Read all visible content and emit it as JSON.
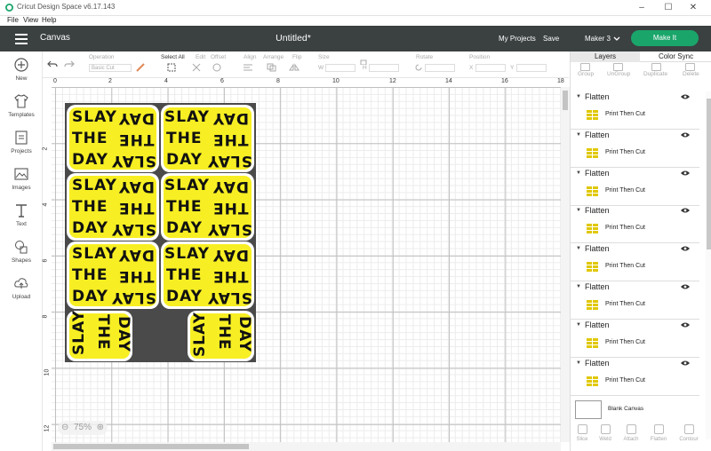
{
  "window": {
    "title": "Cricut Design Space  v6.17.143",
    "minimize": "–",
    "maximize": "☐",
    "close": "✕"
  },
  "menu": [
    "File",
    "View",
    "Help"
  ],
  "header": {
    "page": "Canvas",
    "doc_title": "Untitled*",
    "my_projects": "My Projects",
    "save": "Save",
    "machine": "Maker 3",
    "make_it": "Make It",
    "accent": "#1aa56b",
    "bar_color": "#3b4041"
  },
  "toolbar": {
    "operation_label": "Operation",
    "operation_value": "Basic Cut",
    "select_all": "Select All",
    "edit": "Edit",
    "offset": "Offset",
    "align": "Align",
    "arrange": "Arrange",
    "flip": "Flip",
    "size": "Size",
    "size_w": "W",
    "size_h": "H",
    "rotate": "Rotate",
    "position": "Position",
    "pos_x": "X",
    "pos_y": "Y"
  },
  "sidebar": [
    {
      "label": "New",
      "icon": "plus-circle-icon"
    },
    {
      "label": "Templates",
      "icon": "shirt-icon"
    },
    {
      "label": "Projects",
      "icon": "projects-icon"
    },
    {
      "label": "Images",
      "icon": "image-icon"
    },
    {
      "label": "Text",
      "icon": "text-icon"
    },
    {
      "label": "Shapes",
      "icon": "shapes-icon"
    },
    {
      "label": "Upload",
      "icon": "upload-cloud-icon"
    }
  ],
  "ruler_top": [
    "0",
    "2",
    "4",
    "6",
    "8",
    "10",
    "12",
    "14",
    "16",
    "18"
  ],
  "ruler_left": [
    "2",
    "4",
    "6",
    "8",
    "10",
    "12"
  ],
  "stickers": {
    "line1": "SLAY",
    "line2": "THE",
    "line3": "DAY",
    "fill": "#f7ef23",
    "mat": "#4a4a4a"
  },
  "zoom": "75%",
  "panel": {
    "tabs": [
      "Layers",
      "Color Sync"
    ],
    "actions": [
      "Group",
      "UnGroup",
      "Duplicate",
      "Delete"
    ],
    "layers": [
      {
        "name": "Flatten",
        "op": "Print Then Cut"
      },
      {
        "name": "Flatten",
        "op": "Print Then Cut"
      },
      {
        "name": "Flatten",
        "op": "Print Then Cut"
      },
      {
        "name": "Flatten",
        "op": "Print Then Cut"
      },
      {
        "name": "Flatten",
        "op": "Print Then Cut"
      },
      {
        "name": "Flatten",
        "op": "Print Then Cut"
      },
      {
        "name": "Flatten",
        "op": "Print Then Cut"
      },
      {
        "name": "Flatten",
        "op": "Print Then Cut"
      }
    ],
    "blank_canvas": "Blank Canvas",
    "bottom_actions": [
      "Slice",
      "Weld",
      "Attach",
      "Flatten",
      "Contour"
    ]
  }
}
